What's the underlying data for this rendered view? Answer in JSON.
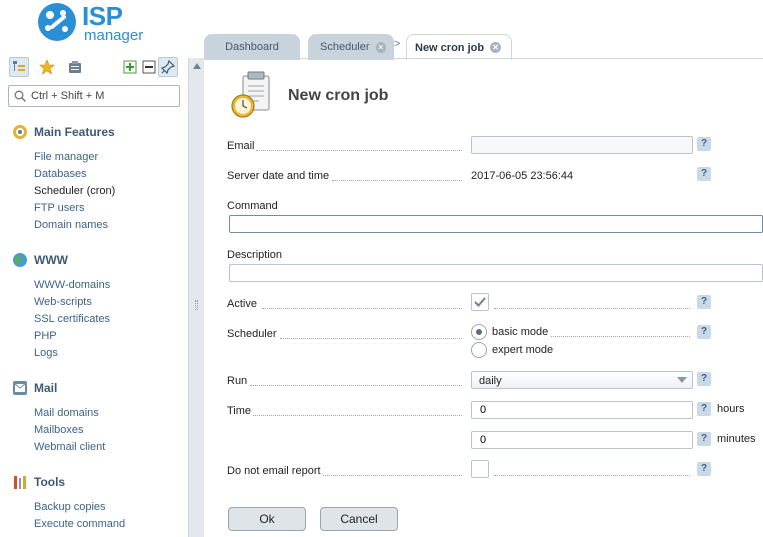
{
  "logo": {
    "isp": "ISP",
    "manager": "manager"
  },
  "search": {
    "placeholder": "Ctrl + Shift + M"
  },
  "sidebar": {
    "sections": [
      {
        "title": "Main Features",
        "items": [
          "File manager",
          "Databases",
          "Scheduler (cron)",
          "FTP users",
          "Domain names"
        ]
      },
      {
        "title": "WWW",
        "items": [
          "WWW-domains",
          "Web-scripts",
          "SSL certificates",
          "PHP",
          "Logs"
        ]
      },
      {
        "title": "Mail",
        "items": [
          "Mail domains",
          "Mailboxes",
          "Webmail client"
        ]
      },
      {
        "title": "Tools",
        "items": [
          "Backup copies",
          "Execute command"
        ]
      }
    ]
  },
  "tabs": [
    {
      "label": "Dashboard"
    },
    {
      "label": "Scheduler"
    },
    {
      "label": "New cron job"
    }
  ],
  "page": {
    "title": "New cron job"
  },
  "form": {
    "email": {
      "label": "Email",
      "value": ""
    },
    "server_time": {
      "label": "Server date and time",
      "value": "2017-06-05 23:56:44"
    },
    "command": {
      "label": "Command",
      "value": ""
    },
    "description": {
      "label": "Description",
      "value": ""
    },
    "active": {
      "label": "Active",
      "checked": true
    },
    "scheduler": {
      "label": "Scheduler",
      "options": [
        "basic mode",
        "expert mode"
      ],
      "selected": "basic mode"
    },
    "run": {
      "label": "Run",
      "value": "daily"
    },
    "time": {
      "label": "Time",
      "hours_value": "0",
      "hours_unit": "hours",
      "minutes_value": "0",
      "minutes_unit": "minutes"
    },
    "no_email": {
      "label": "Do not email report",
      "checked": false
    },
    "help": "?"
  },
  "buttons": {
    "ok": "Ok",
    "cancel": "Cancel"
  },
  "colors": {
    "brand": "#2a8fd6",
    "nav_link": "#3d6386",
    "section_title": "#3d5a73"
  }
}
